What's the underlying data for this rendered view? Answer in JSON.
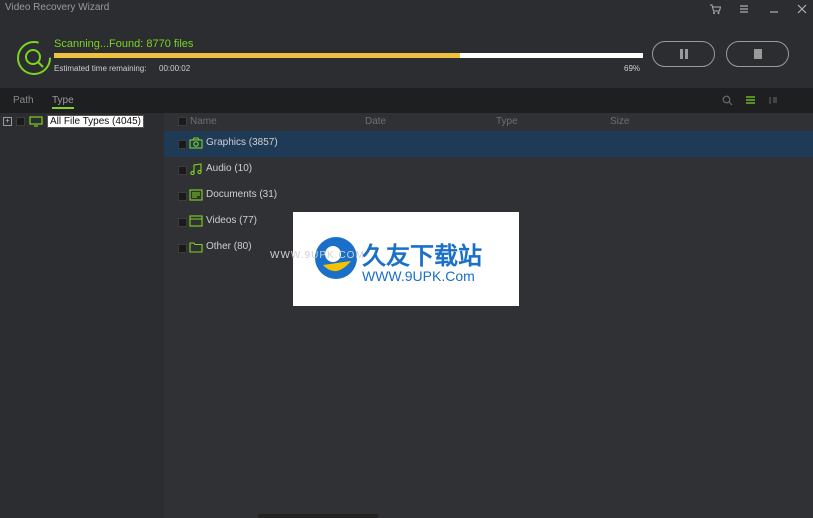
{
  "window": {
    "title": "Video Recovery Wizard"
  },
  "titlebar_icons": [
    "cart-icon",
    "menu-icon",
    "minimize-icon",
    "close-icon"
  ],
  "scan": {
    "status": "Scanning...Found: 8770 files",
    "eta_label": "Estimated time remaining:",
    "eta_value": "00:00:02",
    "percent_label": "69%",
    "progress": 0.69,
    "pause_label": "pause",
    "stop_label": "stop"
  },
  "tabs": [
    {
      "label": "Path",
      "active": false
    },
    {
      "label": "Type",
      "active": true
    }
  ],
  "tree": {
    "root_label": "All File Types (4045)"
  },
  "columns": {
    "name": "Name",
    "date": "Date",
    "type": "Type",
    "size": "Size"
  },
  "rows": [
    {
      "label": "Graphics (3857)",
      "icon": "camera-icon",
      "selected": true
    },
    {
      "label": "Audio (10)",
      "icon": "music-note-icon",
      "selected": false
    },
    {
      "label": "Documents (31)",
      "icon": "document-icon",
      "selected": false
    },
    {
      "label": "Videos (77)",
      "icon": "video-icon",
      "selected": false
    },
    {
      "label": "Other (80)",
      "icon": "folder-icon",
      "selected": false
    }
  ],
  "watermark": {
    "cn": "久友下载站",
    "url": "WWW.9UPK.Com",
    "www": "WWW.9UPK.COM"
  },
  "colors": {
    "accent": "#7ed321",
    "progress": "#f0c040",
    "selected_row": "#1f3a57"
  }
}
